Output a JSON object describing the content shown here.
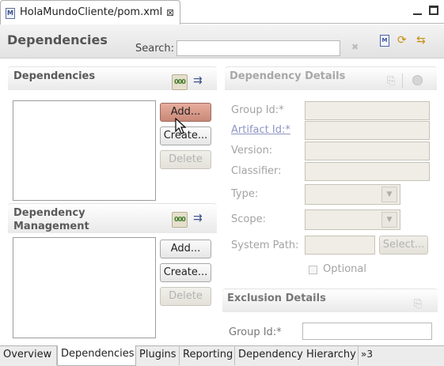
{
  "editor": {
    "tab_title": "HolaMundoCliente/pom.xml",
    "file_icon": "M",
    "close_glyph": "⊠"
  },
  "header": {
    "title": "Dependencies",
    "search_label": "Search:",
    "search_value": "",
    "pom_icon_glyph": "M"
  },
  "dependencies": {
    "title": "Dependencies",
    "filter_glyph": "000",
    "buttons": {
      "add": "Add...",
      "create": "Create...",
      "delete": "Delete"
    }
  },
  "dependency_management": {
    "title_line1": "Dependency",
    "title_line2": "Management",
    "filter_glyph": "000",
    "buttons": {
      "add": "Add...",
      "create": "Create...",
      "delete": "Delete"
    }
  },
  "dependency_details": {
    "title": "Dependency Details",
    "labels": {
      "group_id": "Group Id:*",
      "artifact_id": "Artifact Id:*",
      "version": "Version:",
      "classifier": "Classifier:",
      "type": "Type:",
      "scope": "Scope:",
      "system_path": "System Path:"
    },
    "select_button": "Select...",
    "optional_label": "Optional",
    "optional_checked": false
  },
  "exclusion_details": {
    "title": "Exclusion Details",
    "group_id_label": "Group Id:*"
  },
  "page_tabs": {
    "overview": "Overview",
    "dependencies": "Dependencies",
    "plugins": "Plugins",
    "reporting": "Reporting",
    "hierarchy": "Dependency Hierarchy",
    "overflow": "»3",
    "selected": "Dependencies"
  },
  "icons": {
    "editor_file": "maven-pom-file-icon",
    "close": "close-tab-icon",
    "minimize": "minimize-icon",
    "maximize": "maximize-icon",
    "clear_search": "clear-search-icon",
    "pom_xml": "pom-xml-icon",
    "refresh": "refresh-icon",
    "sync": "sync-icon",
    "filter": "filter-icon",
    "sort": "sort-icon",
    "open_pom": "open-pom-icon",
    "javadoc": "javadoc-icon",
    "cursor": "mouse-cursor-icon"
  },
  "colors": {
    "accent_pressed_button": "#c98877",
    "section_title": "#5a5a5a",
    "disabled_text": "#a3a3a3",
    "link": "#8d95c4"
  }
}
